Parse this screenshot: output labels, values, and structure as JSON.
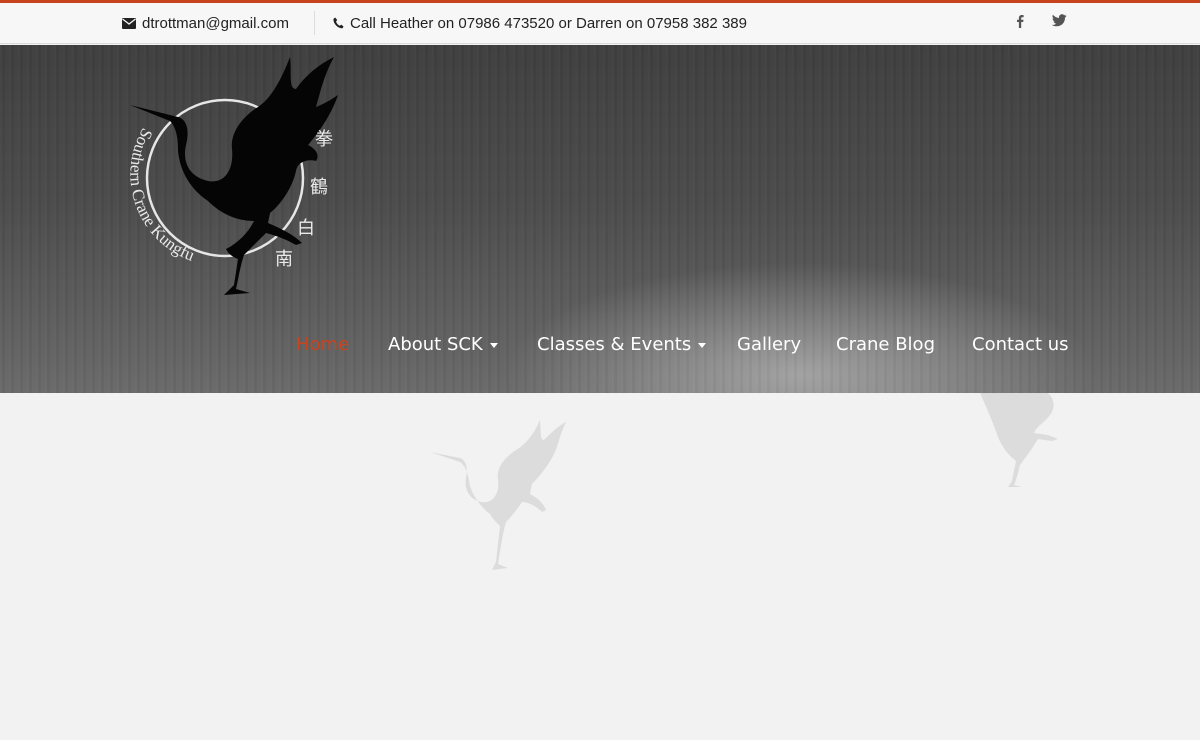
{
  "topbar": {
    "email": "dtrottman@gmail.com",
    "phone": "Call Heather on 07986 473520 or Darren on 07958 382 389",
    "email_icon": "envelope-icon",
    "phone_icon": "phone-icon",
    "social": [
      {
        "name": "facebook-icon"
      },
      {
        "name": "twitter-icon"
      }
    ]
  },
  "logo": {
    "text": "Southern Crane Kungfu",
    "cjk": [
      "拳",
      "鶴",
      "白",
      "南"
    ]
  },
  "nav": {
    "items": [
      {
        "label": "Home",
        "active": true,
        "dropdown": false
      },
      {
        "label": "About SCK",
        "active": false,
        "dropdown": true
      },
      {
        "label": "Classes & Events",
        "active": false,
        "dropdown": true
      },
      {
        "label": "Gallery",
        "active": false,
        "dropdown": false
      },
      {
        "label": "Crane Blog",
        "active": false,
        "dropdown": false
      },
      {
        "label": "Contact us",
        "active": false,
        "dropdown": false
      }
    ]
  },
  "colors": {
    "accent": "#c8441f",
    "topbar_bg": "#f7f7f7",
    "content_bg": "#f2f2f2"
  }
}
